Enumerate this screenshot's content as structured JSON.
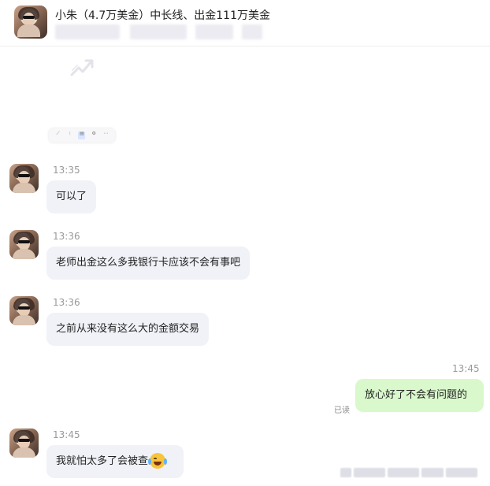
{
  "header": {
    "title": "小朱（4.7万美金）中长线、出金111万美金"
  },
  "messages": [
    {
      "time": "13:35",
      "text": "可以了",
      "side": "left"
    },
    {
      "time": "13:36",
      "text": "老师出金这么多我银行卡应该不会有事吧",
      "side": "left"
    },
    {
      "time": "13:36",
      "text": "之前从来没有这么大的金额交易",
      "side": "left"
    },
    {
      "time": "13:45",
      "text": "放心好了不会有问题的",
      "side": "right",
      "status": "已读"
    },
    {
      "time": "13:45",
      "text": "我就怕太多了会被查",
      "side": "left",
      "emoji": "face-with-tears-of-joy"
    }
  ],
  "colors": {
    "left_bubble": "#f0f2f7",
    "right_bubble": "#d9f8cc",
    "time_text": "#999999"
  }
}
